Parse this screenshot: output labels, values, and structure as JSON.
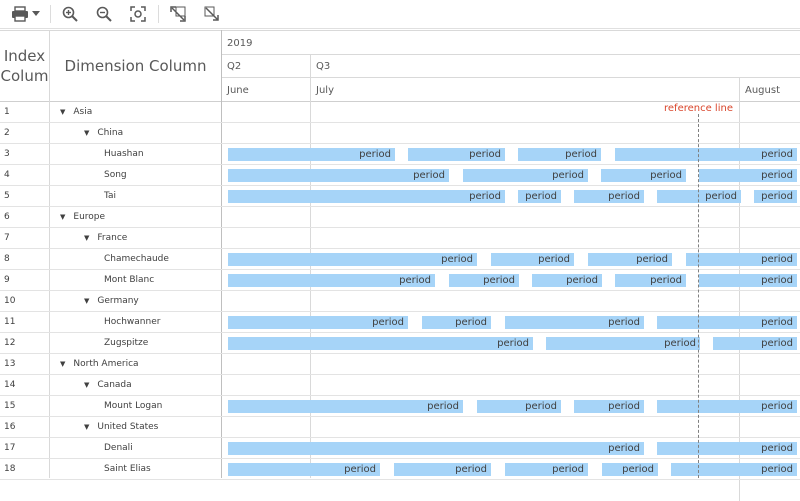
{
  "toolbar": {
    "print": "printer-icon",
    "dropdown": "caret-down-icon",
    "zoom_in": "zoom-in-icon",
    "zoom_out": "zoom-out-icon",
    "fit": "fit-screen-icon",
    "expand": "expand-icon",
    "collapse": "collapse-icon"
  },
  "headers": {
    "index": "Index Colum",
    "dimension": "Dimension Column",
    "year": "2019",
    "quarters": [
      "Q2",
      "Q3"
    ],
    "months": [
      "June",
      "July",
      "August"
    ]
  },
  "reference_line": {
    "label": "reference line",
    "color": "#d9462c"
  },
  "colors": {
    "bar": "#a6d4f8"
  },
  "bar_label": "period",
  "rows": [
    {
      "index": "1",
      "label": "Asia",
      "level": 0,
      "expandable": true
    },
    {
      "index": "2",
      "label": "China",
      "level": 1,
      "expandable": true
    },
    {
      "index": "3",
      "label": "Huashan",
      "level": 2,
      "expandable": false
    },
    {
      "index": "4",
      "label": "Song",
      "level": 2,
      "expandable": false
    },
    {
      "index": "5",
      "label": "Tai",
      "level": 2,
      "expandable": false
    },
    {
      "index": "6",
      "label": "Europe",
      "level": 0,
      "expandable": true
    },
    {
      "index": "7",
      "label": "France",
      "level": 1,
      "expandable": true
    },
    {
      "index": "8",
      "label": "Chamechaude",
      "level": 2,
      "expandable": false
    },
    {
      "index": "9",
      "label": "Mont Blanc",
      "level": 2,
      "expandable": false
    },
    {
      "index": "10",
      "label": "Germany",
      "level": 1,
      "expandable": true
    },
    {
      "index": "11",
      "label": "Hochwanner",
      "level": 2,
      "expandable": false
    },
    {
      "index": "12",
      "label": "Zugspitze",
      "level": 2,
      "expandable": false
    },
    {
      "index": "13",
      "label": "North America",
      "level": 0,
      "expandable": true
    },
    {
      "index": "14",
      "label": "Canada",
      "level": 1,
      "expandable": true
    },
    {
      "index": "15",
      "label": "Mount Logan",
      "level": 2,
      "expandable": false
    },
    {
      "index": "16",
      "label": "United States",
      "level": 1,
      "expandable": true
    },
    {
      "index": "17",
      "label": "Denali",
      "level": 2,
      "expandable": false
    },
    {
      "index": "18",
      "label": "Saint Elias",
      "level": 2,
      "expandable": false
    }
  ]
}
